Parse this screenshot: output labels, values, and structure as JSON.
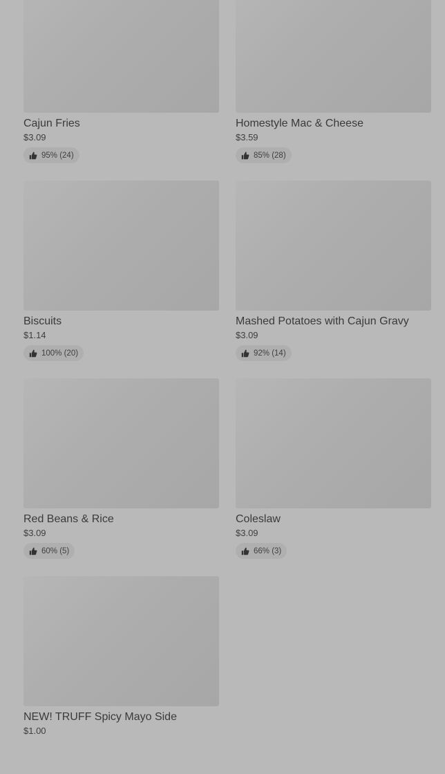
{
  "items": [
    {
      "name": "Cajun Fries",
      "price": "$3.09",
      "rating": "95% (24)"
    },
    {
      "name": "Homestyle Mac & Cheese",
      "price": "$3.59",
      "rating": "85% (28)"
    },
    {
      "name": "Biscuits",
      "price": "$1.14",
      "rating": "100% (20)"
    },
    {
      "name": "Mashed Potatoes with Cajun Gravy",
      "price": "$3.09",
      "rating": "92% (14)"
    },
    {
      "name": "Red Beans & Rice",
      "price": "$3.09",
      "rating": "60% (5)"
    },
    {
      "name": "Coleslaw",
      "price": "$3.09",
      "rating": "66% (3)"
    },
    {
      "name": "NEW! TRUFF Spicy Mayo Side",
      "price": "$1.00",
      "rating": ""
    }
  ],
  "icons": {
    "rating": "thumbs-up-icon"
  }
}
